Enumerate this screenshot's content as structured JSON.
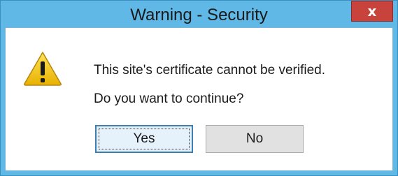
{
  "window": {
    "title": "Warning - Security",
    "close_label": "x"
  },
  "dialog": {
    "icon": "warning-icon",
    "message_line1": "This site's certificate cannot be verified.",
    "message_line2": "Do you want to continue?",
    "yes_label": "Yes",
    "no_label": "No"
  },
  "colors": {
    "frame": "#5fb8e6",
    "close": "#c7433b",
    "warning": "#f2c600"
  }
}
